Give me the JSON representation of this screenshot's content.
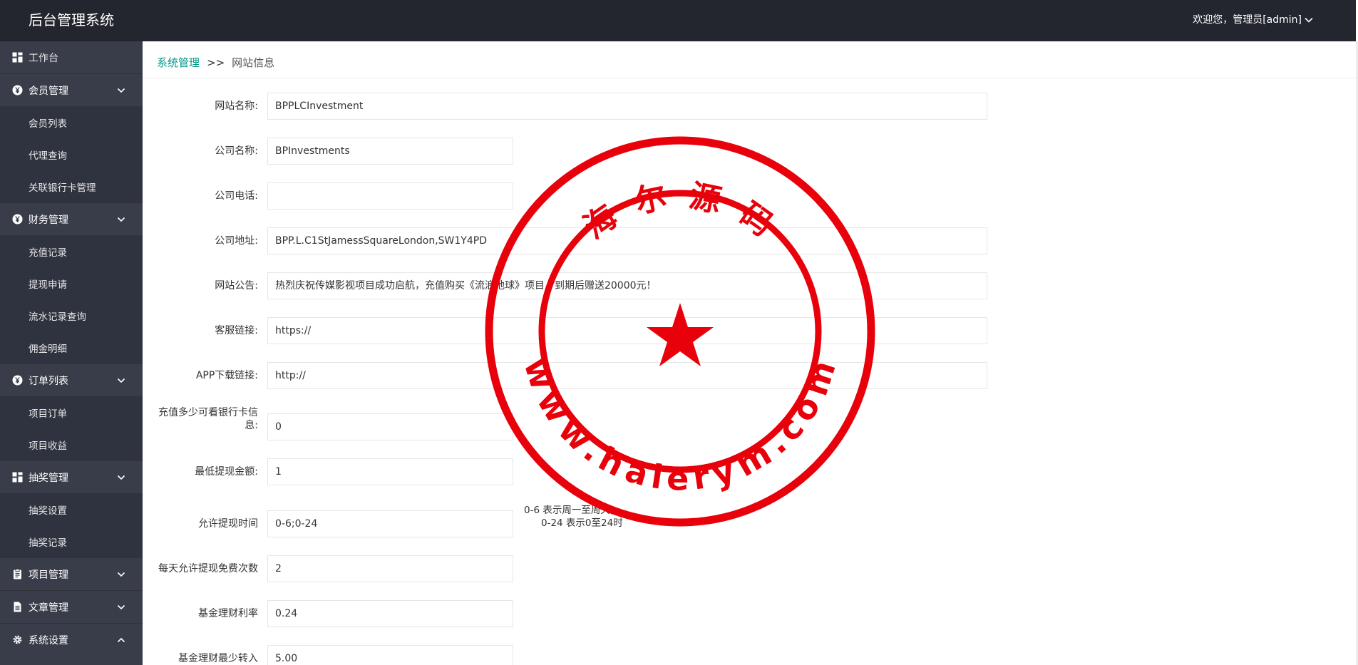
{
  "header": {
    "title": "后台管理系统",
    "user_label": "欢迎您，管理员[admin]"
  },
  "sidebar": {
    "workbench": "工作台",
    "groups": [
      {
        "label": "会员管理",
        "icon": "yen-circle-icon",
        "items": [
          "会员列表",
          "代理查询",
          "关联银行卡管理"
        ]
      },
      {
        "label": "财务管理",
        "icon": "yen-circle-icon",
        "items": [
          "充值记录",
          "提现申请",
          "流水记录查询",
          "佣金明细"
        ]
      },
      {
        "label": "订单列表",
        "icon": "yen-circle-icon",
        "items": [
          "项目订单",
          "项目收益"
        ]
      },
      {
        "label": "抽奖管理",
        "icon": "dashboard-grid-icon",
        "items": [
          "抽奖设置",
          "抽奖记录"
        ]
      },
      {
        "label": "项目管理",
        "icon": "clipboard-icon",
        "items": []
      },
      {
        "label": "文章管理",
        "icon": "document-icon",
        "items": []
      },
      {
        "label": "系统设置",
        "icon": "gear-icon",
        "items": []
      }
    ]
  },
  "breadcrumb": {
    "parent": "系统管理",
    "separator": ">>",
    "current": "网站信息"
  },
  "form": {
    "site_name": {
      "label": "网站名称:",
      "value": "BPPLCInvestment"
    },
    "company_name": {
      "label": "公司名称:",
      "value": "BPInvestments"
    },
    "company_phone": {
      "label": "公司电话:",
      "value": ""
    },
    "company_address": {
      "label": "公司地址:",
      "value": "BPP.L.C1StJamessSquareLondon,SW1Y4PD"
    },
    "site_notice": {
      "label": "网站公告:",
      "value": "热烈庆祝传媒影视项目成功启航，充值购买《流浪地球》项目，到期后赠送20000元！"
    },
    "service_link": {
      "label": "客服链接:",
      "value": "https://"
    },
    "app_link": {
      "label": "APP下载链接:",
      "value": "http://"
    },
    "recharge_view_bank": {
      "label_line1": "充值多少可看银行卡信",
      "label_line2": "息:",
      "value": "0"
    },
    "min_withdraw": {
      "label": "最低提现金额:",
      "value": "1"
    },
    "withdraw_time": {
      "label": "允许提现时间",
      "value": "0-6;0-24",
      "hint_line1": "0-6 表示周一至周天,",
      "hint_line2": "0-24 表示0至24时"
    },
    "free_withdraw_times": {
      "label": "每天允许提现免费次数",
      "value": "2"
    },
    "fund_rate": {
      "label": "基金理财利率",
      "value": "0.24"
    },
    "fund_min_in": {
      "label": "基金理财最少转入",
      "value": "5.00"
    }
  },
  "watermark": {
    "top_text": "海 尔 源 码",
    "bottom_text": "www.haierym.com",
    "color": "#e8000b"
  },
  "colors": {
    "topbar": "#23262e",
    "sidebar": "#393d49",
    "sidebar_sub": "#2f3340",
    "accent": "#009688"
  }
}
